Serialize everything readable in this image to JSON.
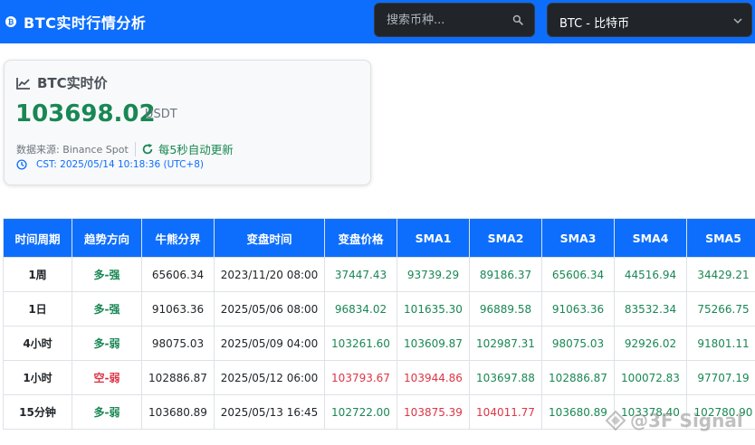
{
  "header": {
    "title": "BTC实时行情分析",
    "brand_icon": "bitcoin-icon",
    "search_placeholder": "搜索币种...",
    "selected_coin": "BTC - 比特币",
    "colors": {
      "primary": "#0d6efd",
      "dark": "#212529"
    }
  },
  "price_card": {
    "title": "BTC实时价",
    "price": "103698.02",
    "unit": "USDT",
    "source": "数据来源: Binance Spot",
    "refresh": "每5秒自动更新",
    "time": "CST: 2025/05/14 10:18:36 (UTC+8)",
    "colors": {
      "price": "#198754",
      "time": "#0d6efd"
    }
  },
  "table": {
    "headers": [
      "时间周期",
      "趋势方向",
      "牛熊分界",
      "变盘时间",
      "变盘价格",
      "SMA1",
      "SMA2",
      "SMA3",
      "SMA4",
      "SMA5"
    ],
    "rows": [
      {
        "period": "1周",
        "trend": "多-强",
        "trend_color": "green",
        "boundary": "65606.34",
        "turn_time": "2023/11/20 08:00",
        "cells": [
          {
            "v": "37447.43",
            "c": "green"
          },
          {
            "v": "93739.29",
            "c": "green"
          },
          {
            "v": "89186.37",
            "c": "green"
          },
          {
            "v": "65606.34",
            "c": "green"
          },
          {
            "v": "44516.94",
            "c": "green"
          },
          {
            "v": "34429.21",
            "c": "green"
          }
        ]
      },
      {
        "period": "1日",
        "trend": "多-强",
        "trend_color": "green",
        "boundary": "91063.36",
        "turn_time": "2025/05/06 08:00",
        "cells": [
          {
            "v": "96834.02",
            "c": "green"
          },
          {
            "v": "101635.30",
            "c": "green"
          },
          {
            "v": "96889.58",
            "c": "green"
          },
          {
            "v": "91063.36",
            "c": "green"
          },
          {
            "v": "83532.34",
            "c": "green"
          },
          {
            "v": "75266.75",
            "c": "green"
          }
        ]
      },
      {
        "period": "4小时",
        "trend": "多-弱",
        "trend_color": "green",
        "boundary": "98075.03",
        "turn_time": "2025/05/09 04:00",
        "cells": [
          {
            "v": "103261.60",
            "c": "green"
          },
          {
            "v": "103609.87",
            "c": "green"
          },
          {
            "v": "102987.31",
            "c": "green"
          },
          {
            "v": "98075.03",
            "c": "green"
          },
          {
            "v": "92926.02",
            "c": "green"
          },
          {
            "v": "91801.11",
            "c": "green"
          }
        ]
      },
      {
        "period": "1小时",
        "trend": "空-弱",
        "trend_color": "red",
        "boundary": "102886.87",
        "turn_time": "2025/05/12 06:00",
        "cells": [
          {
            "v": "103793.67",
            "c": "red"
          },
          {
            "v": "103944.86",
            "c": "red"
          },
          {
            "v": "103697.88",
            "c": "green"
          },
          {
            "v": "102886.87",
            "c": "green"
          },
          {
            "v": "100072.83",
            "c": "green"
          },
          {
            "v": "97707.19",
            "c": "green"
          }
        ]
      },
      {
        "period": "15分钟",
        "trend": "多-弱",
        "trend_color": "green",
        "boundary": "103680.89",
        "turn_time": "2025/05/13 16:45",
        "cells": [
          {
            "v": "102722.00",
            "c": "green"
          },
          {
            "v": "103875.39",
            "c": "red"
          },
          {
            "v": "104011.77",
            "c": "red"
          },
          {
            "v": "103680.89",
            "c": "green"
          },
          {
            "v": "103378.40",
            "c": "green"
          },
          {
            "v": "102780.90",
            "c": "green"
          }
        ]
      }
    ]
  },
  "watermark": "@3F Signal"
}
